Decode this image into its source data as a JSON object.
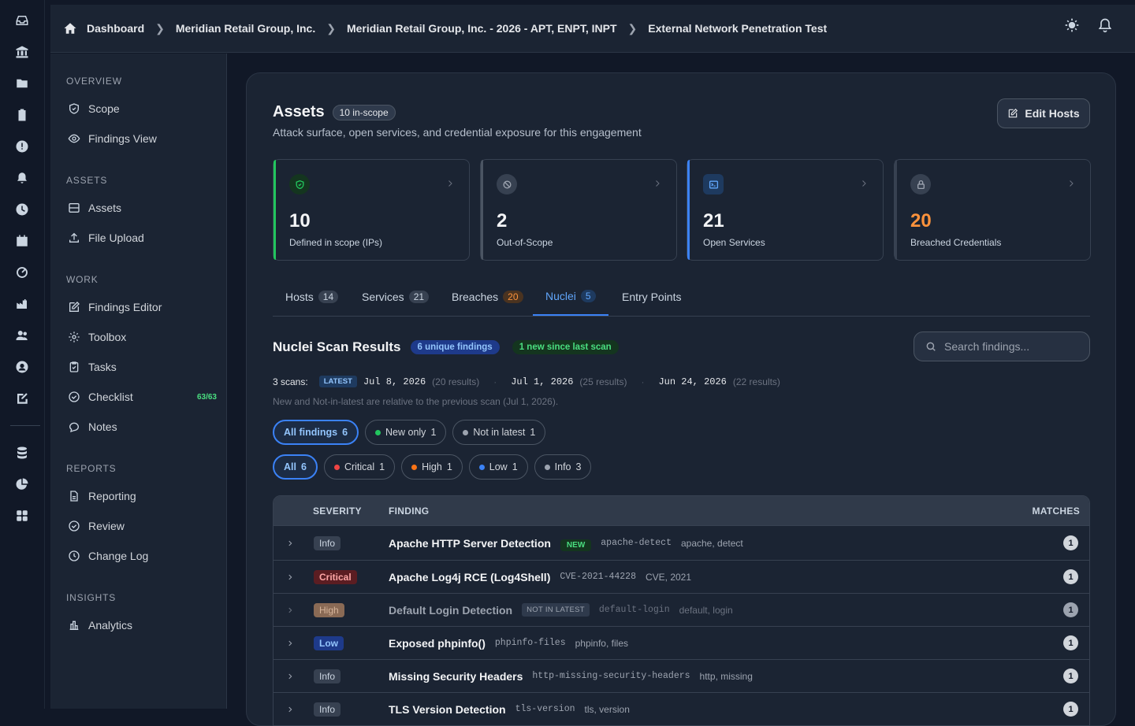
{
  "breadcrumb": [
    "Dashboard",
    "Meridian Retail Group, Inc.",
    "Meridian Retail Group, Inc. - 2026 - APT, ENPT, INPT",
    "External Network Penetration Test"
  ],
  "sidebar": {
    "sections": [
      {
        "title": "OVERVIEW",
        "items": [
          {
            "label": "Scope",
            "icon": "shield-icon"
          },
          {
            "label": "Findings View",
            "icon": "eye-icon"
          }
        ]
      },
      {
        "title": "ASSETS",
        "items": [
          {
            "label": "Assets",
            "icon": "server-icon"
          },
          {
            "label": "File Upload",
            "icon": "upload-icon"
          }
        ]
      },
      {
        "title": "WORK",
        "items": [
          {
            "label": "Findings Editor",
            "icon": "edit-icon"
          },
          {
            "label": "Toolbox",
            "icon": "gear-icon"
          },
          {
            "label": "Tasks",
            "icon": "clipboard-icon"
          },
          {
            "label": "Checklist",
            "icon": "check-circle-icon",
            "badge": "63/63"
          },
          {
            "label": "Notes",
            "icon": "chat-icon"
          }
        ]
      },
      {
        "title": "REPORTS",
        "items": [
          {
            "label": "Reporting",
            "icon": "document-icon"
          },
          {
            "label": "Review",
            "icon": "check-circle-icon"
          },
          {
            "label": "Change Log",
            "icon": "clock-icon"
          }
        ]
      },
      {
        "title": "INSIGHTS",
        "items": [
          {
            "label": "Analytics",
            "icon": "bar-chart-icon"
          }
        ]
      }
    ]
  },
  "header": {
    "title": "Assets",
    "scope_pill": "10 in-scope",
    "subtitle": "Attack surface, open services, and credential exposure for this engagement",
    "edit_label": "Edit Hosts"
  },
  "cards": [
    {
      "value": "10",
      "label": "Defined in scope (IPs)",
      "accent": "#22c55e",
      "value_color": "#f3f4f6"
    },
    {
      "value": "2",
      "label": "Out-of-Scope",
      "accent": "#4b5563",
      "value_color": "#f3f4f6"
    },
    {
      "value": "21",
      "label": "Open Services",
      "accent": "#3b82f6",
      "value_color": "#f3f4f6"
    },
    {
      "value": "20",
      "label": "Breached Credentials",
      "accent": "#374151",
      "value_color": "#fb923c"
    }
  ],
  "tabs": [
    {
      "label": "Hosts",
      "count": "14"
    },
    {
      "label": "Services",
      "count": "21"
    },
    {
      "label": "Breaches",
      "count": "20"
    },
    {
      "label": "Nuclei",
      "count": "5"
    },
    {
      "label": "Entry Points",
      "count": ""
    }
  ],
  "nuclei": {
    "title": "Nuclei Scan Results",
    "unique": "6 unique findings",
    "new_since": "1 new since last scan",
    "search_placeholder": "Search findings...",
    "scans_label": "3 scans:",
    "latest_label": "LATEST",
    "scans": [
      {
        "date": "Jul 8, 2026",
        "results": "(20 results)"
      },
      {
        "date": "Jul 1, 2026",
        "results": "(25 results)"
      },
      {
        "date": "Jun 24, 2026",
        "results": "(22 results)"
      }
    ],
    "note": "New and Not-in-latest are relative to the previous scan (Jul 1, 2026).",
    "filters1": [
      {
        "label": "All findings",
        "count": "6"
      },
      {
        "label": "New only",
        "count": "1"
      },
      {
        "label": "Not in latest",
        "count": "1"
      }
    ],
    "filters2": [
      {
        "label": "All",
        "count": "6"
      },
      {
        "label": "Critical",
        "count": "1"
      },
      {
        "label": "High",
        "count": "1"
      },
      {
        "label": "Low",
        "count": "1"
      },
      {
        "label": "Info",
        "count": "3"
      }
    ],
    "columns": {
      "severity": "SEVERITY",
      "finding": "FINDING",
      "matches": "MATCHES"
    },
    "rows": [
      {
        "severity": "Info",
        "name": "Apache HTTP Server Detection",
        "badge": "NEW",
        "template": "apache-detect",
        "tags": "apache, detect",
        "matches": "1"
      },
      {
        "severity": "Critical",
        "name": "Apache Log4j RCE (Log4Shell)",
        "badge": "",
        "template": "CVE-2021-44228",
        "tags": "CVE, 2021",
        "matches": "1"
      },
      {
        "severity": "High",
        "name": "Default Login Detection",
        "badge": "NOT IN LATEST",
        "template": "default-login",
        "tags": "default, login",
        "matches": "1"
      },
      {
        "severity": "Low",
        "name": "Exposed phpinfo()",
        "badge": "",
        "template": "phpinfo-files",
        "tags": "phpinfo, files",
        "matches": "1"
      },
      {
        "severity": "Info",
        "name": "Missing Security Headers",
        "badge": "",
        "template": "http-missing-security-headers",
        "tags": "http, missing",
        "matches": "1"
      },
      {
        "severity": "Info",
        "name": "TLS Version Detection",
        "badge": "",
        "template": "tls-version",
        "tags": "tls, version",
        "matches": "1"
      }
    ]
  }
}
